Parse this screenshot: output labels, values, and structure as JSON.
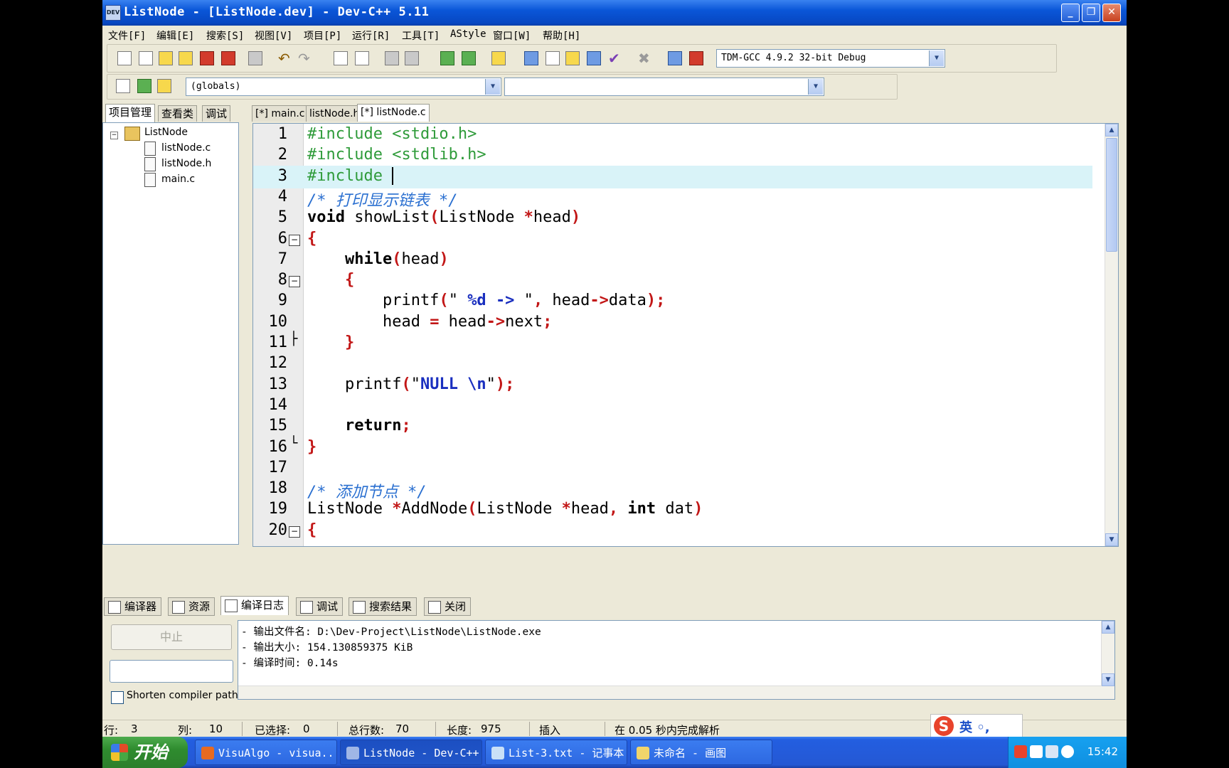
{
  "window": {
    "title": "ListNode - [ListNode.dev] - Dev-C++ 5.11",
    "app_icon": "devcpp-icon",
    "controls": [
      "minimize",
      "restore",
      "close"
    ]
  },
  "menu": [
    "文件[F]",
    "编辑[E]",
    "搜索[S]",
    "视图[V]",
    "项目[P]",
    "运行[R]",
    "工具[T]",
    "AStyle",
    "窗口[W]",
    "帮助[H]"
  ],
  "toolbar": {
    "compiler": "TDM-GCC 4.9.2 32-bit Debug",
    "scope": "(globals)",
    "function": ""
  },
  "left_panel": {
    "tabs": [
      "项目管理",
      "查看类",
      "调试"
    ],
    "active_tab": 0,
    "project": "ListNode",
    "files": [
      "listNode.c",
      "listNode.h",
      "main.c"
    ]
  },
  "editor": {
    "tabs": [
      "[*] main.c",
      "listNode.h",
      "[*] listNode.c"
    ],
    "active_tab": 2,
    "current_line": 3,
    "lines": [
      {
        "n": "1",
        "fold": "",
        "html": "<span class=\"pp\">#include &lt;stdio.h&gt;</span>"
      },
      {
        "n": "2",
        "fold": "",
        "html": "<span class=\"pp\">#include &lt;stdlib.h&gt;</span>"
      },
      {
        "n": "3",
        "fold": "",
        "html": "<span class=\"pp\">#include </span><span style=\"border-left:2px solid #000\">&#8203;</span>"
      },
      {
        "n": "4",
        "fold": "",
        "html": "<span class=\"cm\">/* 打印显示链表 */</span>"
      },
      {
        "n": "5",
        "fold": "",
        "html": "<span class=\"kw\">void</span> showList<span class=\"sym\">(</span>ListNode <span class=\"sym\">*</span>head<span class=\"sym\">)</span>"
      },
      {
        "n": "6",
        "fold": "box",
        "html": "<span class=\"sym\">{</span>"
      },
      {
        "n": "7",
        "fold": "",
        "html": "    <span class=\"kw\">while</span><span class=\"sym\">(</span>head<span class=\"sym\">)</span>"
      },
      {
        "n": "8",
        "fold": "box",
        "html": "    <span class=\"sym\">{</span>"
      },
      {
        "n": "9",
        "fold": "",
        "html": "        printf<span class=\"sym\">(</span>\" <span class=\"fmt\">%d</span> <span class=\"fmt\">-&gt;</span> \"<span class=\"sym\">,</span> head<span class=\"sym\">-&gt;</span>data<span class=\"sym\">);</span>"
      },
      {
        "n": "10",
        "fold": "",
        "html": "        head <span class=\"sym\">=</span> head<span class=\"sym\">-&gt;</span>next<span class=\"sym\">;</span>"
      },
      {
        "n": "11",
        "fold": "end",
        "html": "    <span class=\"sym\">}</span>"
      },
      {
        "n": "12",
        "fold": "",
        "html": ""
      },
      {
        "n": "13",
        "fold": "",
        "html": "    printf<span class=\"sym\">(</span>\"<span class=\"fmt\">NULL \\n</span>\"<span class=\"sym\">);</span>"
      },
      {
        "n": "14",
        "fold": "",
        "html": ""
      },
      {
        "n": "15",
        "fold": "",
        "html": "    <span class=\"kw\">return</span><span class=\"sym\">;</span>"
      },
      {
        "n": "16",
        "fold": "endlast",
        "html": "<span class=\"sym\">}</span>"
      },
      {
        "n": "17",
        "fold": "",
        "html": ""
      },
      {
        "n": "18",
        "fold": "",
        "html": "<span class=\"cm\">/* 添加节点 */</span>"
      },
      {
        "n": "19",
        "fold": "",
        "html": "ListNode <span class=\"sym\">*</span>AddNode<span class=\"sym\">(</span>ListNode <span class=\"sym\">*</span>head<span class=\"sym\">,</span> <span class=\"kw\">int</span> dat<span class=\"sym\">)</span>"
      },
      {
        "n": "20",
        "fold": "box",
        "html": "<span class=\"sym\">{</span>"
      }
    ]
  },
  "bottom_tabs": [
    "编译器",
    "资源",
    "编译日志",
    "调试",
    "搜索结果",
    "关闭"
  ],
  "bottom_active": 2,
  "bottom_panel": {
    "stop_label": "中止",
    "shorten_label": "Shorten compiler paths",
    "log": [
      "- 输出文件名: D:\\Dev-Project\\ListNode\\ListNode.exe",
      "- 输出大小: 154.130859375 KiB",
      "- 编译时间: 0.14s"
    ]
  },
  "status": {
    "row_label": "行:",
    "row": "3",
    "col_label": "列:",
    "col": "10",
    "sel_label": "已选择:",
    "sel": "0",
    "total_label": "总行数:",
    "total": "70",
    "len_label": "长度:",
    "len": "975",
    "mode": "插入",
    "parse": "在 0.05 秒内完成解析"
  },
  "ime": {
    "logo": "S",
    "lang": "英 ◦,"
  },
  "taskbar": {
    "start": "开始",
    "tasks": [
      {
        "label": "VisuAlgo - visua...",
        "icon": "firefox-icon",
        "color": "#e76a20"
      },
      {
        "label": "ListNode - Dev-C++",
        "icon": "devcpp-icon",
        "color": "#9fb6e6"
      },
      {
        "label": "List-3.txt - 记事本",
        "icon": "notepad-icon",
        "color": "#c9e0f7"
      },
      {
        "label": "未命名 - 画图",
        "icon": "paint-icon",
        "color": "#f1d56b"
      }
    ],
    "active_task": 1,
    "clock": "15:42"
  }
}
